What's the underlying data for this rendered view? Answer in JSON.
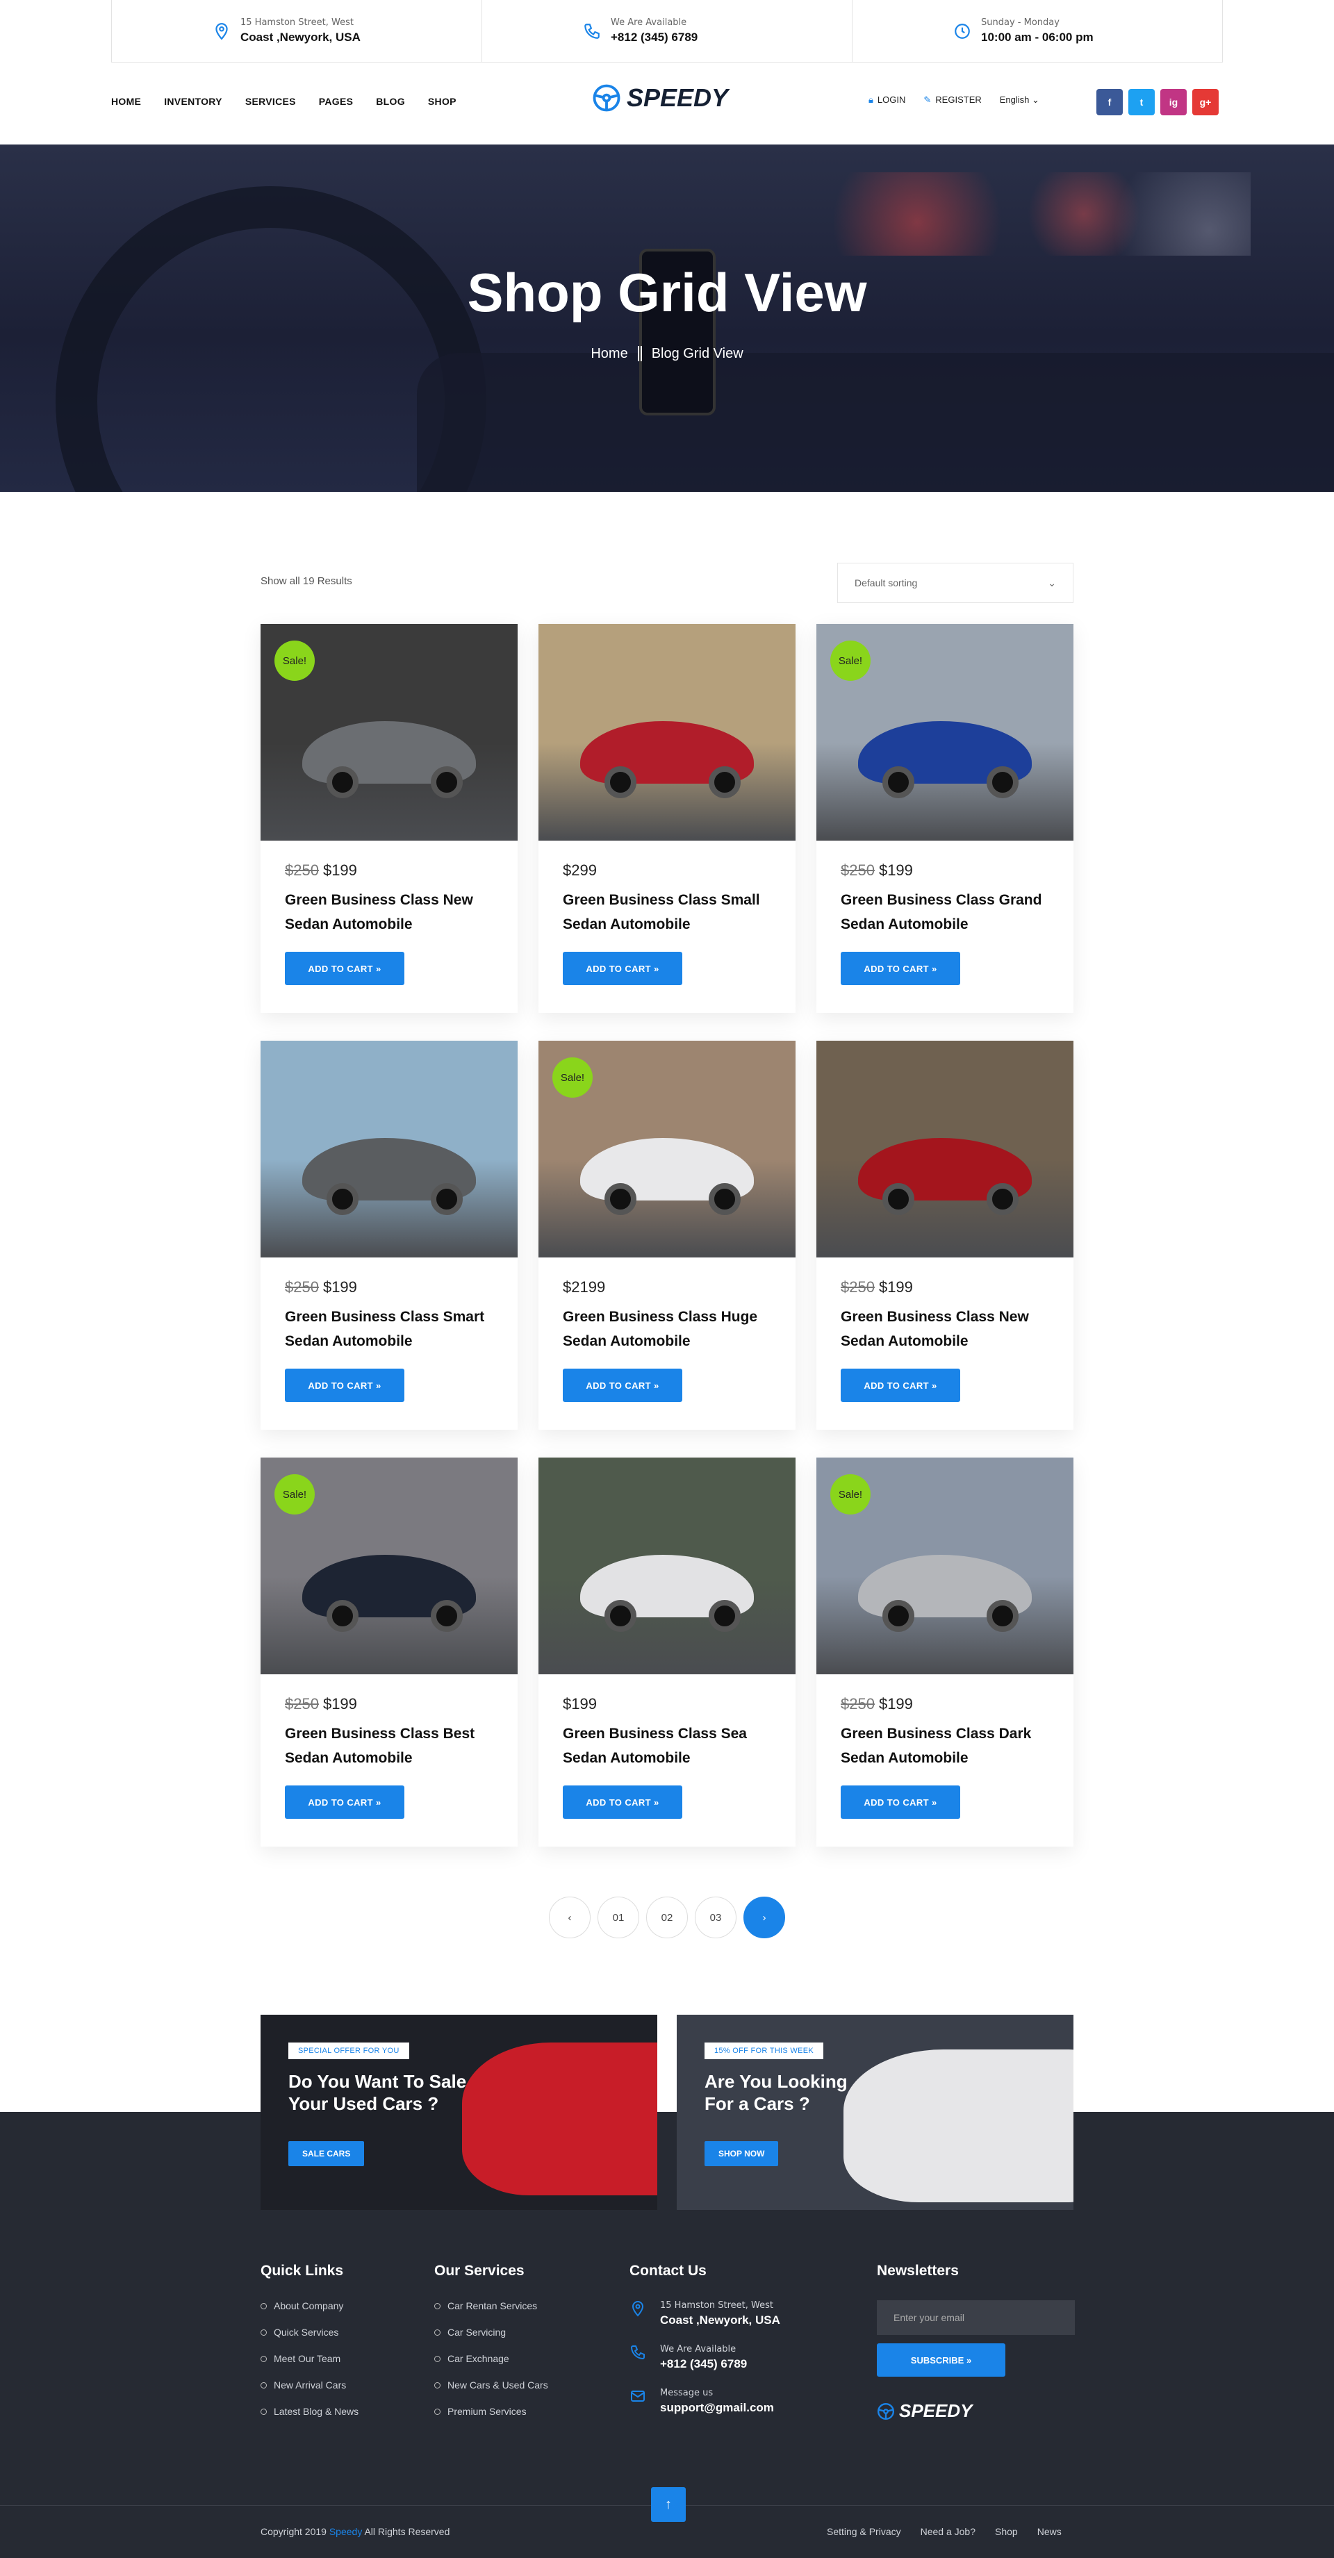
{
  "topbar": [
    {
      "icon": "map-pin-icon",
      "small": "15 Hamston Street, West",
      "big": "Coast ,Newyork, USA"
    },
    {
      "icon": "phone-icon",
      "small": "We Are Available",
      "big": "+812 (345) 6789"
    },
    {
      "icon": "clock-icon",
      "small": "Sunday - Monday",
      "big": "10:00 am - 06:00 pm"
    }
  ],
  "menu": [
    "HOME",
    "INVENTORY",
    "SERVICES",
    "PAGES",
    "BLOG",
    "SHOP"
  ],
  "logo": "SPEEDY",
  "nav": {
    "login": "LOGIN",
    "register": "REGISTER",
    "language": "English"
  },
  "social": [
    {
      "label": "f",
      "color": "#3b5998"
    },
    {
      "label": "t",
      "color": "#1da1f2"
    },
    {
      "label": "ig",
      "color": "#c13584"
    },
    {
      "label": "g+",
      "color": "#e53935"
    }
  ],
  "hero": {
    "title": "Shop Grid View",
    "crumb_home": "Home",
    "crumb_current": "Blog Grid View"
  },
  "results": "Show all 19 Results",
  "sort": "Default sorting",
  "sale_label": "Sale!",
  "add_to_cart": "ADD TO CART",
  "products": [
    {
      "old": "$250",
      "price": "$199",
      "title": "Green Business Class New Sedan Automobile",
      "sale": true,
      "bg": "#3b3b3b",
      "car": "#6b6e72"
    },
    {
      "old": "",
      "price": "$299",
      "title": "Green Business Class Small Sedan Automobile",
      "sale": false,
      "bg": "#b5a07c",
      "car": "#b11d2a"
    },
    {
      "old": "$250",
      "price": "$199",
      "title": "Green Business Class Grand Sedan Automobile",
      "sale": true,
      "bg": "#9aa4b0",
      "car": "#1d3f9a"
    },
    {
      "old": "$250",
      "price": "$199",
      "title": "Green Business Class Smart Sedan Automobile",
      "sale": false,
      "bg": "#8fb0c8",
      "car": "#5a5d60"
    },
    {
      "old": "",
      "price": "$2199",
      "title": "Green Business Class Huge Sedan Automobile",
      "sale": true,
      "bg": "#9d8570",
      "car": "#e8e8ea"
    },
    {
      "old": "$250",
      "price": "$199",
      "title": "Green Business Class New Sedan Automobile",
      "sale": false,
      "bg": "#6f6150",
      "car": "#a4151d"
    },
    {
      "old": "$250",
      "price": "$199",
      "title": "Green Business Class Best Sedan Automobile",
      "sale": true,
      "bg": "#7b7a80",
      "car": "#1d2433"
    },
    {
      "old": "",
      "price": "$199",
      "title": "Green Business Class Sea Sedan Automobile",
      "sale": false,
      "bg": "#4f5a4c",
      "car": "#e2e2e4"
    },
    {
      "old": "$250",
      "price": "$199",
      "title": "Green Business Class Dark Sedan Automobile",
      "sale": true,
      "bg": "#8a95a5",
      "car": "#b4b6ba"
    }
  ],
  "pager": [
    "‹",
    "01",
    "02",
    "03",
    "›"
  ],
  "promos": [
    {
      "tag": "SPECIAL OFFER FOR YOU",
      "heading_1": "Do You Want To Sale",
      "heading_2": "Your Used Cars ?",
      "button": "SALE CARS",
      "bg": "#1e2027",
      "car": "#c81d28"
    },
    {
      "tag": "15% OFF FOR THIS WEEK",
      "heading_1": "Are You Looking",
      "heading_2": "For a Cars ?",
      "button": "SHOP NOW",
      "bg": "#3a3f4a",
      "car": "#e6e6e8"
    }
  ],
  "footer": {
    "quick_title": "Quick Links",
    "quick": [
      "About Company",
      "Quick Services",
      "Meet Our Team",
      "New Arrival Cars",
      "Latest Blog & News"
    ],
    "services_title": "Our Services",
    "services": [
      "Car Rentan Services",
      "Car Servicing",
      "Car Exchnage",
      "New Cars & Used Cars",
      "Premium Services"
    ],
    "contact_title": "Contact Us",
    "contact": [
      {
        "icon": "map-pin-icon",
        "small": "15 Hamston Street, West",
        "big": "Coast ,Newyork, USA"
      },
      {
        "icon": "phone-icon",
        "small": "We Are Available",
        "big": "+812 (345) 6789"
      },
      {
        "icon": "envelope-icon",
        "small": "Message us",
        "big": "support@gmail.com"
      }
    ],
    "newsletter_title": "Newsletters",
    "email_placeholder": "Enter your email",
    "subscribe": "SUBSCRIBE",
    "logo": "SPEEDY",
    "copy_prefix": "Copyright  2019 ",
    "copy_brand": "Speedy",
    "copy_suffix": " All Rights Reserved",
    "links": [
      "Setting & Privacy",
      "Need a Job?",
      "Shop",
      "News"
    ]
  },
  "colors": {
    "accent": "#1a84e8",
    "sale": "#8ad51b",
    "footer": "#262a33"
  }
}
